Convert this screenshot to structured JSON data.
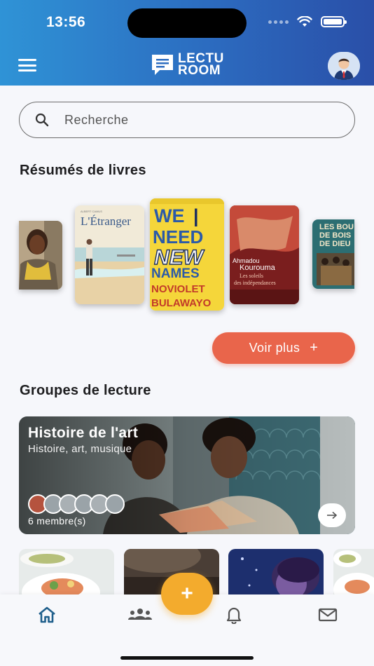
{
  "status_bar": {
    "time": "13:56"
  },
  "header": {
    "logo_line1": "LECTU",
    "logo_line2": "ROOM",
    "menu_icon": "hamburger-menu-icon",
    "avatar_icon": "user-avatar-icon"
  },
  "search": {
    "placeholder": "Recherche",
    "icon": "search-icon"
  },
  "summaries": {
    "title": "Résumés de livres",
    "books": [
      {
        "name": "book-cover-portrait",
        "title": ""
      },
      {
        "name": "book-cover-letranger",
        "title": "L'Étranger"
      },
      {
        "name": "book-cover-we-need-new-names",
        "title": "WE NEED NEW NAMES",
        "author": "NOVIOLET BULAWAYO"
      },
      {
        "name": "book-cover-les-soleils",
        "title": "Les soleils des indépendances",
        "author": "Ahmadou Kourouma"
      },
      {
        "name": "book-cover-les-bouts-de-bois",
        "title": "LES BOUTS DE BOIS DE DIEU"
      }
    ],
    "more_label": "Voir plus",
    "more_icon": "+"
  },
  "groups": {
    "title": "Groupes de lecture",
    "featured": {
      "name": "Histoire de l'art",
      "tags": "Histoire, art, musique",
      "members_label": "6 membre(s)"
    }
  },
  "bottom_nav": {
    "items": [
      "home-icon",
      "groups-icon",
      "bell-icon",
      "mail-icon"
    ],
    "fab_label": "+"
  },
  "colors": {
    "header_start": "#2f93d6",
    "header_end": "#2a4fa8",
    "accent_orange": "#e9654b",
    "fab_yellow": "#f3ab2d",
    "nav_active": "#1f5f8b"
  }
}
